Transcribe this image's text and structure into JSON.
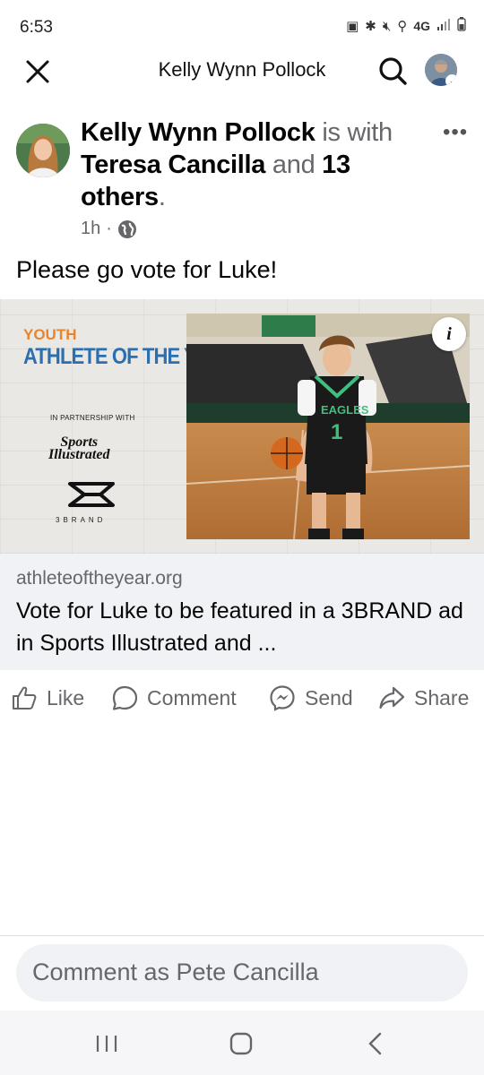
{
  "status_bar": {
    "time": "6:53",
    "network": "4G"
  },
  "header": {
    "title": "Kelly Wynn Pollock"
  },
  "post": {
    "author": "Kelly Wynn Pollock",
    "is_with": "is with",
    "tagged_person": "Teresa Cancilla",
    "and_word": "and",
    "others": "13 others",
    "period": ".",
    "time": "1h",
    "separator": "·",
    "text": "Please go vote for Luke!"
  },
  "link_card": {
    "image": {
      "youth": "YOUTH",
      "athlete_of_the_year": "ATHLETE OF THE YEAR",
      "partnership": "IN PARTNERSHIP WITH",
      "si_line1": "Sports",
      "si_line2": "Illustrated",
      "brand": "3BRAND",
      "jersey_team": "EAGLES",
      "jersey_number": "1",
      "info_icon_label": "i"
    },
    "domain": "athleteoftheyear.org",
    "title": "Vote for Luke to be featured in a 3BRAND ad in Sports Illustrated and ..."
  },
  "actions": {
    "like": "Like",
    "comment": "Comment",
    "send": "Send",
    "share": "Share"
  },
  "comment_bar": {
    "placeholder": "Comment as Pete Cancilla"
  },
  "icons": {
    "close": "close-icon",
    "search": "search-icon",
    "more": "more-options-icon",
    "globe": "globe-icon",
    "like": "thumbs-up-icon",
    "comment": "comment-bubble-icon",
    "send": "messenger-icon",
    "share": "share-arrow-icon"
  }
}
